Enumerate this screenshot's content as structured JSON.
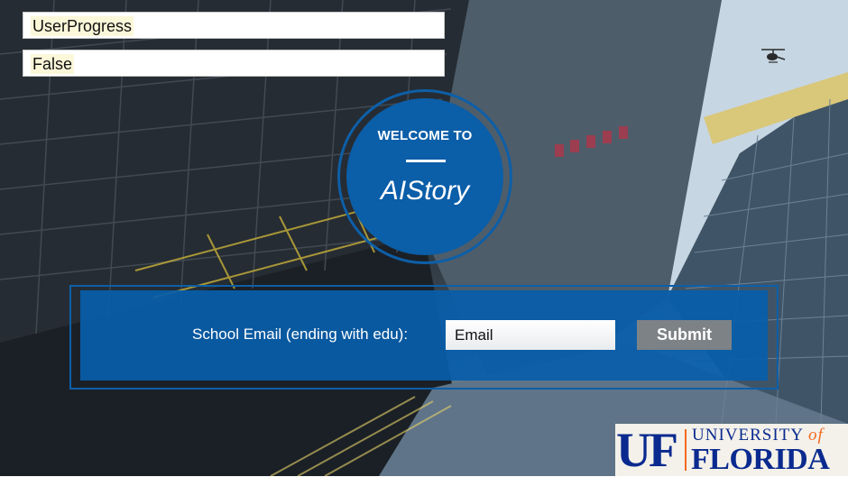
{
  "variables": [
    {
      "value": "UserProgress"
    },
    {
      "value": "False"
    }
  ],
  "welcome": {
    "heading": "WELCOME TO",
    "title": "AIStory"
  },
  "signup": {
    "email_label": "School Email (ending with edu):",
    "email_placeholder": "Email",
    "submit_label": "Submit"
  },
  "logo": {
    "uf": "UF",
    "university": "UNIVERSITY",
    "of": "of",
    "florida": "FLORIDA"
  },
  "colors": {
    "brand_blue": "#0b5ea8",
    "button_gray": "#7d8286",
    "uf_blue": "#0a2a8f",
    "uf_orange": "#f26a21"
  },
  "icons": [
    "helicopter-icon"
  ]
}
